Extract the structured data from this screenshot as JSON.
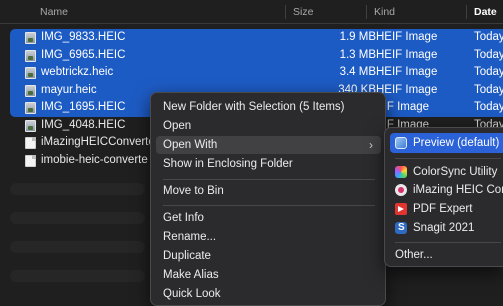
{
  "columns": {
    "name": "Name",
    "size": "Size",
    "kind": "Kind",
    "date": "Date L"
  },
  "files": [
    {
      "name": "IMG_9833.HEIC",
      "size": "1.9 MB",
      "kind": "HEIF Image",
      "date": "Today",
      "selected": true,
      "icon": "image-file-icon"
    },
    {
      "name": "IMG_6965.HEIC",
      "size": "1.3 MB",
      "kind": "HEIF Image",
      "date": "Today",
      "selected": true,
      "icon": "image-file-icon"
    },
    {
      "name": "webtrickz.heic",
      "size": "3.4 MB",
      "kind": "HEIF Image",
      "date": "Today",
      "selected": true,
      "icon": "image-file-icon"
    },
    {
      "name": "mayur.heic",
      "size": "340 KB",
      "kind": "HEIF Image",
      "date": "Today",
      "selected": true,
      "icon": "image-file-icon"
    },
    {
      "name": "IMG_1695.HEIC",
      "size": "",
      "kind": "EIF Image",
      "date": "Today",
      "selected": true,
      "icon": "image-file-icon"
    },
    {
      "name": "IMG_4048.HEIC",
      "size": "",
      "kind": "EIF Image",
      "date": "Today",
      "selected": false,
      "icon": "image-file-icon"
    },
    {
      "name": "iMazingHEICConverte",
      "size": "",
      "kind": "",
      "date": "",
      "selected": false,
      "icon": "document-icon"
    },
    {
      "name": "imobie-heic-converte",
      "size": "",
      "kind": "",
      "date": "",
      "selected": false,
      "icon": "document-icon"
    }
  ],
  "context_menu": {
    "new_folder": "New Folder with Selection (5 Items)",
    "open": "Open",
    "open_with": "Open With",
    "open_with_arrow": "›",
    "show_enclosing": "Show in Enclosing Folder",
    "move_to_bin": "Move to Bin",
    "get_info": "Get Info",
    "rename": "Rename...",
    "duplicate": "Duplicate",
    "make_alias": "Make Alias",
    "quick_look": "Quick Look"
  },
  "open_with_submenu": {
    "preview": "Preview (default)",
    "colorsync": "ColorSync Utility",
    "imazing": "iMazing HEIC Con",
    "pdf_expert": "PDF Expert",
    "snagit": "Snagit 2021",
    "other": "Other..."
  },
  "colors": {
    "selection": "#1d5bc4",
    "menu_highlight": "#2b62d8",
    "background": "#1f1f1f"
  }
}
